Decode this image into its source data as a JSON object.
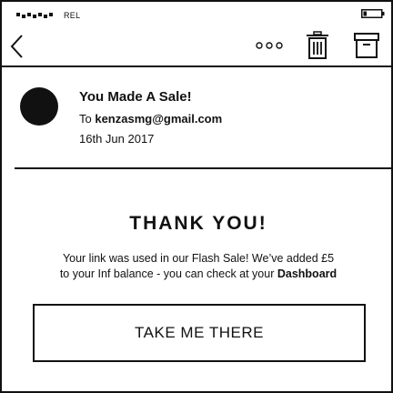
{
  "status_bar": {
    "carrier": "REL",
    "signal_icon": "signal-strength-icon",
    "battery_icon": "battery-icon"
  },
  "toolbar": {
    "back_icon": "chevron-left-icon",
    "more_icon": "more-dots-icon",
    "delete_icon": "trash-icon",
    "archive_icon": "archive-box-icon"
  },
  "message": {
    "subject": "You Made A Sale!",
    "to_prefix": "To ",
    "to_email": "kenzasmg@gmail.com",
    "date": "16th Jun 2017"
  },
  "body": {
    "heading": "THANK YOU!",
    "line1": "Your link was used in our Flash Sale! We’ve added £5",
    "line2_prefix": "to your Inf balance - you can check at your ",
    "line2_link": "Dashboard",
    "cta_label": "TAKE ME THERE"
  },
  "colors": {
    "ink": "#111111",
    "background": "#ffffff"
  }
}
